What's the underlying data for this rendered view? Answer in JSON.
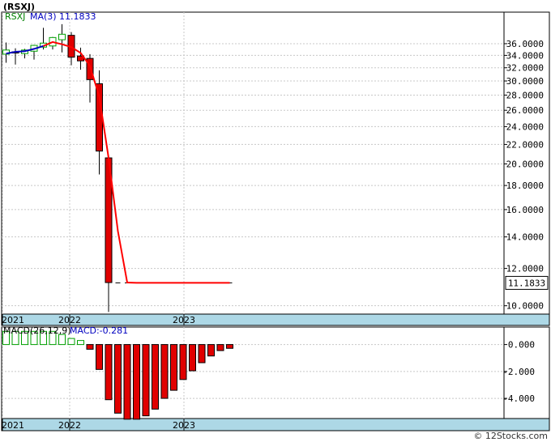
{
  "title": "(RSXJ)",
  "watermark": "© 12Stocks.com",
  "legend": {
    "ticker": "RSXJ",
    "ma_label": "MA(3)",
    "ma_value": "11.1833"
  },
  "macd_legend": {
    "params": "MACD(26,12,9)",
    "value_label": "MACD:-0.281"
  },
  "last_price_label": "11.1833",
  "x_labels": [
    "2021",
    "2022",
    "2023"
  ],
  "colors": {
    "up": "#00a000",
    "down": "#e00000",
    "ma": "#ff0000",
    "ma_early": "#0000c0",
    "axis_band": "#add8e6",
    "grid": "#c8c8c8"
  },
  "chart_data": [
    {
      "type": "candlestick",
      "title": "(RSXJ)",
      "xlabels": [
        "2021",
        "2022",
        "2023"
      ],
      "y_scale": "log",
      "ylim": [
        9.6,
        42
      ],
      "yticks": [
        10,
        12,
        14,
        16,
        18,
        20,
        22,
        24,
        26,
        28,
        30,
        32,
        34,
        36
      ],
      "ytick_labels": [
        "10.0000",
        "12.0000",
        "14.0000",
        "16.0000",
        "18.0000",
        "20.0000",
        "22.0000",
        "24.0000",
        "26.0000",
        "28.0000",
        "30.0000",
        "32.0000",
        "34.0000",
        "36.0000"
      ],
      "last_value": 11.1833,
      "candles": [
        {
          "o": 34.2,
          "h": 36.2,
          "l": 32.8,
          "c": 34.9
        },
        {
          "o": 34.6,
          "h": 35.2,
          "l": 32.5,
          "c": 34.4
        },
        {
          "o": 34.3,
          "h": 35.1,
          "l": 33.5,
          "c": 34.9
        },
        {
          "o": 34.7,
          "h": 35.8,
          "l": 33.3,
          "c": 35.7
        },
        {
          "o": 35.4,
          "h": 38.9,
          "l": 35.0,
          "c": 36.1
        },
        {
          "o": 35.6,
          "h": 37.2,
          "l": 35.0,
          "c": 37.1
        },
        {
          "o": 36.7,
          "h": 39.6,
          "l": 34.5,
          "c": 37.7
        },
        {
          "o": 37.5,
          "h": 38.1,
          "l": 32.4,
          "c": 33.7
        },
        {
          "o": 33.9,
          "h": 35.3,
          "l": 31.7,
          "c": 33.1
        },
        {
          "o": 33.5,
          "h": 34.2,
          "l": 27.0,
          "c": 30.2
        },
        {
          "o": 29.6,
          "h": 31.6,
          "l": 19.0,
          "c": 21.3
        },
        {
          "o": 20.6,
          "h": 20.8,
          "l": 9.7,
          "c": 11.2
        }
      ],
      "flat_values": [
        11.1833,
        11.1833,
        11.1833,
        11.1833,
        11.1833,
        11.1833,
        11.1833,
        11.1833,
        11.1833,
        11.1833,
        11.1833,
        11.1833,
        11.1833
      ],
      "ma": [
        34.3,
        34.6,
        34.7,
        35.1,
        35.6,
        36.3,
        35.9,
        35.4,
        34.4,
        32.3,
        27.8,
        20.6,
        14.4,
        11.2,
        11.1833,
        11.1833,
        11.1833,
        11.1833,
        11.1833,
        11.1833,
        11.1833,
        11.1833,
        11.1833,
        11.1833,
        11.1833
      ]
    },
    {
      "type": "bar",
      "title": "MACD(26,12,9)",
      "ylim": [
        -5.5,
        1.3
      ],
      "yticks": [
        0,
        -2,
        -4
      ],
      "ytick_labels": [
        "0.000",
        "-2.000",
        "-4.000"
      ],
      "values": [
        0.98,
        0.98,
        0.98,
        0.98,
        0.98,
        0.98,
        0.75,
        0.45,
        0.3,
        -0.35,
        -1.85,
        -4.1,
        -5.1,
        -5.55,
        -5.55,
        -5.3,
        -4.8,
        -4.0,
        -3.4,
        -2.6,
        -1.95,
        -1.35,
        -0.85,
        -0.45,
        -0.281
      ]
    }
  ]
}
